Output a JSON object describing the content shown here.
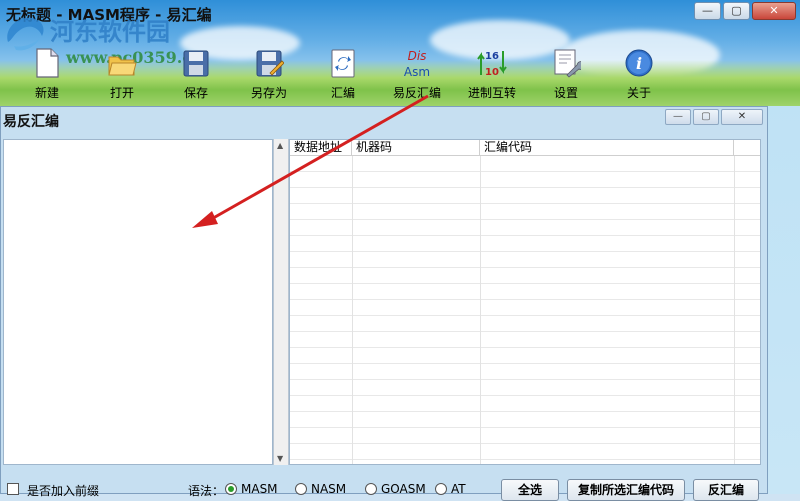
{
  "window": {
    "title": "无标题 - MASM程序 - 易汇编",
    "controls": {
      "minimize": "—",
      "maximize": "▢",
      "close": "✕"
    }
  },
  "watermark": {
    "name": "河东软件园",
    "url": "www.pc0359.cn"
  },
  "toolbar": {
    "items": [
      {
        "label": "新建",
        "icon": "new-file-icon"
      },
      {
        "label": "打开",
        "icon": "open-folder-icon"
      },
      {
        "label": "保存",
        "icon": "save-icon"
      },
      {
        "label": "另存为",
        "icon": "save-as-icon"
      },
      {
        "label": "汇编",
        "icon": "assemble-icon"
      },
      {
        "label": "易反汇编",
        "icon": "disassemble-icon",
        "icon_text_top": "Dis",
        "icon_text_bottom": "Asm"
      },
      {
        "label": "进制互转",
        "icon": "base-convert-icon",
        "icon_text_top": "16",
        "icon_text_bottom": "10"
      },
      {
        "label": "设置",
        "icon": "settings-icon"
      },
      {
        "label": "关于",
        "icon": "about-icon",
        "icon_text": "i"
      }
    ]
  },
  "dialog": {
    "title": "易反汇编",
    "controls": {
      "minimize": "—",
      "maximize": "▢",
      "close": "✕"
    },
    "grid": {
      "columns": [
        "数据地址",
        "机器码",
        "汇编代码"
      ]
    },
    "bottom": {
      "prefix_checkbox": {
        "label": "是否加入前缀",
        "checked": false
      },
      "syntax_label": "语法：",
      "syntax_options": [
        {
          "label": "MASM",
          "selected": true
        },
        {
          "label": "NASM",
          "selected": false
        },
        {
          "label": "GOASM",
          "selected": false
        },
        {
          "label": "AT",
          "selected": false
        }
      ],
      "buttons": {
        "select_all": "全选",
        "copy_selected": "复制所选汇编代码",
        "disassemble": "反汇编"
      }
    }
  },
  "colors": {
    "accent_arrow": "#d42020",
    "radio_selected": "#2a9d2a"
  }
}
